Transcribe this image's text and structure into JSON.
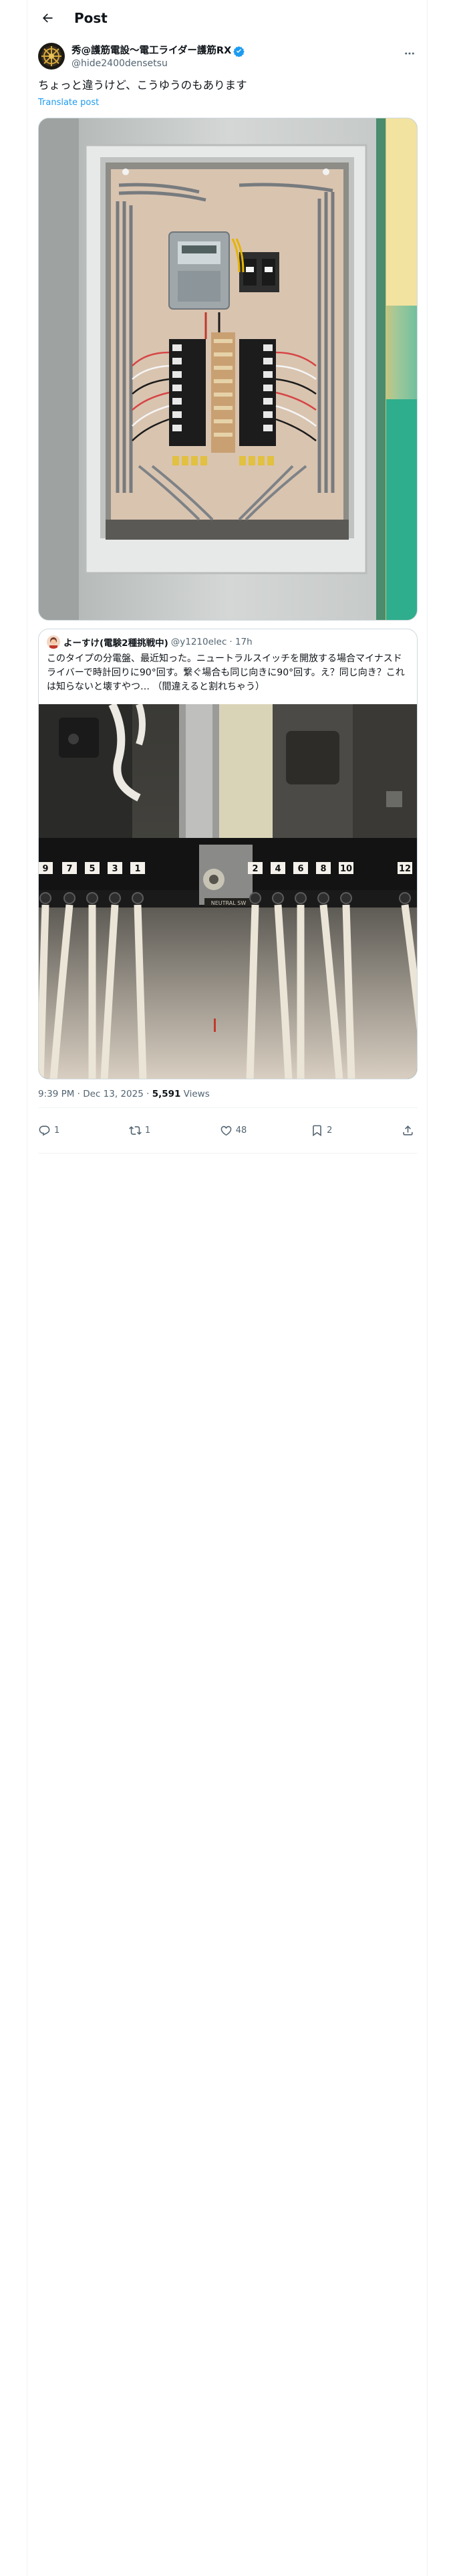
{
  "header": {
    "title": "Post",
    "back_icon": "arrow-left-icon"
  },
  "post": {
    "display_name": "秀@護筋電設〜電工ライダー護筋RX",
    "handle": "@hide2400densetsu",
    "text": "ちょっと違うけど、こうゆうのもあります",
    "translate_label": "Translate post",
    "timestamp": "9:39 PM · Dec 13, 2025 · ",
    "views_count": "5,591",
    "views_label": " Views"
  },
  "quote": {
    "display_name": "よーすけ(電験2種挑戦中)",
    "handle": "@y1210elec",
    "time": "· 17h",
    "text": "このタイプの分電盤、最近知った。ニュートラルスイッチを開放する場合マイナスドライバーで時計回りに90°回す。繋ぐ場合も同じ向きに90°回す。え？同じ向き？これは知らないと壊すやつ… （間違えると割れちゃう）",
    "terminal_labels": [
      "9",
      "7",
      "5",
      "3",
      "1",
      "2",
      "4",
      "6",
      "8",
      "10",
      "12"
    ]
  },
  "actions": {
    "reply": {
      "icon": "reply-icon",
      "count": "1"
    },
    "repost": {
      "icon": "repost-icon",
      "count": "1"
    },
    "like": {
      "icon": "heart-icon",
      "count": "48"
    },
    "bookmark": {
      "icon": "bookmark-icon",
      "count": "2"
    },
    "share": {
      "icon": "share-icon"
    }
  },
  "colors": {
    "accent": "#1d9bf0",
    "text_primary": "#0f1419",
    "text_secondary": "#536471",
    "border": "#cfd9de",
    "verified": "#1d9bf0"
  }
}
